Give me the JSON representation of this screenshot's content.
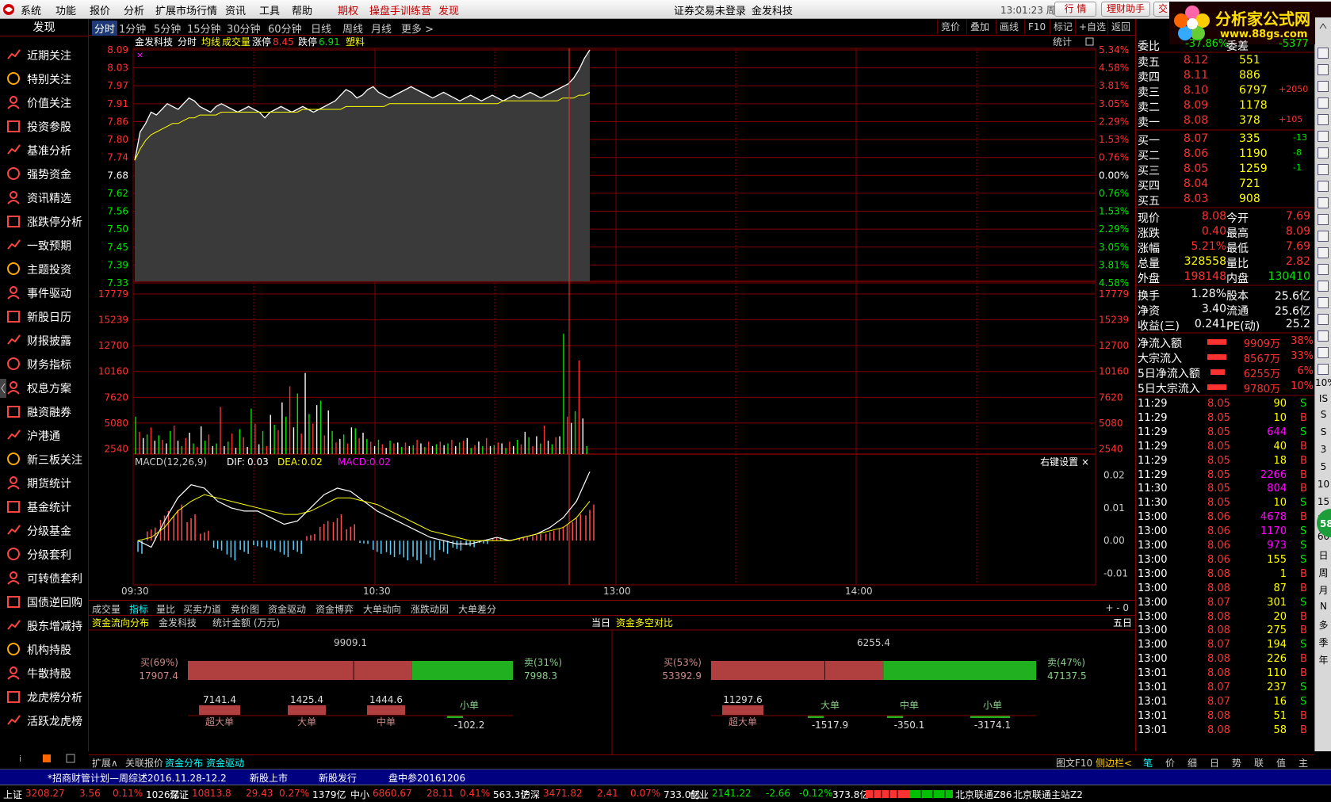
{
  "menu": [
    "系统",
    "功能",
    "报价",
    "分析",
    "扩展市场行情",
    "资讯",
    "工具",
    "帮助"
  ],
  "menu_red": [
    "期权",
    "操盘手训练营",
    "发现"
  ],
  "status_center": "证券交易未登录",
  "stock_name": "金发科技",
  "clock": "13:01:23 周二",
  "top_buttons": [
    "行 情",
    "理财助手",
    "交 易"
  ],
  "logo": {
    "title": "分析家公式网",
    "url": "www.88gs.com"
  },
  "sidebar": {
    "header": "发现",
    "items": [
      "近期关注",
      "特别关注",
      "价值关注",
      "投资参股",
      "基准分析",
      "强势资金",
      "资讯精选",
      "涨跌停分析",
      "一致预期",
      "主题投资",
      "事件驱动",
      "新股日历",
      "财报披露",
      "财务指标",
      "权息方案",
      "融资融券",
      "沪港通",
      "新三板关注",
      "期货统计",
      "基金统计",
      "分级基金",
      "分级套利",
      "可转债套利",
      "国债逆回购",
      "股东增减持",
      "机构持股",
      "牛散持股",
      "龙虎榜分析",
      "活跃龙虎榜"
    ]
  },
  "periods": [
    "分时",
    "1分钟",
    "5分钟",
    "15分钟",
    "30分钟",
    "60分钟",
    "日线",
    "周线",
    "月线",
    "更多 >"
  ],
  "right_buttons": [
    "竞价",
    "叠加",
    "画线",
    "F10",
    "标记",
    "+自选",
    "返回"
  ],
  "chart_header": {
    "name": "金发科技",
    "mode": "分时",
    "avg": "均线",
    "vol": "成交量",
    "limit_up_label": "涨停",
    "limit_up": "8.45",
    "limit_dn_label": "跌停",
    "limit_dn": "6.91",
    "sector": "塑料",
    "stat": "统计"
  },
  "chart_data": {
    "type": "line",
    "price_axis": [
      "8.09",
      "8.03",
      "7.97",
      "7.91",
      "7.86",
      "7.80",
      "7.74",
      "7.68",
      "7.62",
      "7.56",
      "7.50",
      "7.45",
      "7.39",
      "7.33"
    ],
    "pct_axis": [
      "5.34%",
      "4.58%",
      "3.81%",
      "3.05%",
      "2.29%",
      "1.53%",
      "0.76%",
      "0.00%",
      "0.76%",
      "1.53%",
      "2.29%",
      "3.05%",
      "3.81%",
      "4.58%"
    ],
    "base_price": 7.68,
    "ylim": [
      7.3,
      8.09
    ],
    "price": [
      7.7,
      7.8,
      7.83,
      7.87,
      7.86,
      7.88,
      7.9,
      7.89,
      7.88,
      7.9,
      7.92,
      7.91,
      7.89,
      7.88,
      7.87,
      7.89,
      7.9,
      7.89,
      7.88,
      7.87,
      7.88,
      7.89,
      7.88,
      7.87,
      7.85,
      7.87,
      7.88,
      7.89,
      7.88,
      7.87,
      7.88,
      7.89,
      7.88,
      7.87,
      7.88,
      7.89,
      7.9,
      7.91,
      7.93,
      7.95,
      7.94,
      7.92,
      7.93,
      7.95,
      7.96,
      7.94,
      7.93,
      7.92,
      7.93,
      7.94,
      7.95,
      7.96,
      7.95,
      7.94,
      7.93,
      7.92,
      7.93,
      7.94,
      7.93,
      7.92,
      7.91,
      7.92,
      7.93,
      7.92,
      7.91,
      7.92,
      7.93,
      7.92,
      7.91,
      7.92,
      7.93,
      7.92,
      7.93,
      7.94,
      7.93,
      7.92,
      7.93,
      7.94,
      7.95,
      7.96,
      7.97,
      7.99,
      8.02,
      8.06,
      8.09
    ],
    "avg": [
      7.7,
      7.74,
      7.77,
      7.79,
      7.8,
      7.81,
      7.82,
      7.83,
      7.83,
      7.84,
      7.85,
      7.85,
      7.86,
      7.86,
      7.86,
      7.86,
      7.87,
      7.87,
      7.87,
      7.87,
      7.87,
      7.87,
      7.87,
      7.87,
      7.87,
      7.87,
      7.87,
      7.87,
      7.87,
      7.87,
      7.87,
      7.88,
      7.88,
      7.88,
      7.88,
      7.88,
      7.88,
      7.88,
      7.88,
      7.89,
      7.89,
      7.89,
      7.89,
      7.89,
      7.89,
      7.89,
      7.89,
      7.9,
      7.9,
      7.9,
      7.9,
      7.9,
      7.9,
      7.9,
      7.9,
      7.9,
      7.9,
      7.9,
      7.9,
      7.9,
      7.9,
      7.9,
      7.9,
      7.9,
      7.9,
      7.9,
      7.9,
      7.9,
      7.91,
      7.91,
      7.91,
      7.91,
      7.91,
      7.91,
      7.91,
      7.91,
      7.91,
      7.91,
      7.91,
      7.92,
      7.92,
      7.92,
      7.93,
      7.93,
      7.94
    ],
    "vol_axis": [
      "17779",
      "15239",
      "12700",
      "10160",
      "7620",
      "5080",
      "2540"
    ],
    "vol_max": 17779,
    "volume": [
      4200,
      2500,
      1800,
      2200,
      3000,
      1500,
      2100,
      1600,
      1200,
      2600,
      3200,
      1500,
      900,
      1800,
      2400,
      1200,
      800,
      3100,
      1500,
      2200,
      900,
      1200,
      5300,
      900,
      1400,
      2300,
      700,
      2800,
      1900,
      800,
      5100,
      3400,
      1100,
      2600,
      900,
      4400,
      3300,
      2700,
      5800,
      4200,
      7600,
      3000,
      6800,
      2300,
      9100,
      4500,
      3400,
      5500,
      6000,
      2100,
      4900,
      2600,
      1300,
      1700,
      2200,
      1200,
      3000,
      2900,
      1800,
      2400,
      1700,
      1400,
      900,
      1600,
      1100,
      700,
      1500,
      1200,
      1300,
      800,
      1300,
      900,
      1000,
      1600,
      1200,
      800,
      1400,
      900,
      1100,
      1400,
      1000,
      1200,
      1600,
      900,
      1300,
      1500,
      1800,
      700,
      1000,
      1400,
      900,
      1800,
      900,
      1000,
      1300,
      1200,
      700,
      1400,
      900,
      1600,
      1100,
      2500,
      1900,
      900,
      2000,
      1200,
      3200,
      1500,
      1100,
      1900,
      2000,
      13500,
      4200,
      3500,
      4800,
      10500,
      4000,
      900
    ],
    "macd": {
      "label": "MACD(12,26,9)",
      "dif_label": "DIF:",
      "dif": "0.03",
      "dea_label": "DEA:",
      "dea": "0.02",
      "macd_label": "MACD:",
      "macd": "0.02",
      "axis": [
        "0.02",
        "0.01",
        "0.00",
        "-0.01"
      ],
      "ylim": [
        -0.012,
        0.022
      ],
      "dif_line": [
        0.0,
        -0.002,
        0.006,
        0.013,
        0.017,
        0.016,
        0.012,
        0.01,
        0.009,
        0.009,
        0.007,
        0.005,
        0.006,
        0.01,
        0.014,
        0.016,
        0.015,
        0.012,
        0.009,
        0.007,
        0.005,
        0.003,
        0.001,
        0.0,
        -0.001,
        -0.001,
        0.0,
        0.001,
        0.0,
        0.001,
        0.002,
        0.004,
        0.007,
        0.012,
        0.021
      ],
      "dea_line": [
        0.0,
        0.001,
        0.004,
        0.009,
        0.012,
        0.014,
        0.013,
        0.012,
        0.011,
        0.01,
        0.009,
        0.008,
        0.008,
        0.009,
        0.011,
        0.013,
        0.013,
        0.012,
        0.011,
        0.009,
        0.007,
        0.005,
        0.003,
        0.002,
        0.001,
        0.0,
        0.0,
        0.0,
        0.0,
        0.001,
        0.002,
        0.003,
        0.004,
        0.007,
        0.012
      ],
      "bars": [
        -0.004,
        0.004,
        0.009,
        0.011,
        0.008,
        0.003,
        -0.003,
        -0.006,
        -0.004,
        -0.002,
        -0.003,
        -0.005,
        -0.004,
        0.002,
        0.006,
        0.008,
        0.005,
        -0.001,
        -0.004,
        -0.005,
        -0.006,
        -0.007,
        -0.006,
        -0.004,
        -0.003,
        -0.002,
        -0.001,
        0.001,
        0.0,
        0.001,
        0.002,
        0.003,
        0.005,
        0.008,
        0.011
      ]
    },
    "time_axis": [
      "09:30",
      "10:30",
      "13:00",
      "14:00"
    ],
    "right_setting": "右键设置 ×"
  },
  "subtabs": [
    "成交量",
    "指标",
    "量比",
    "买卖力道",
    "竞价图",
    "资金驱动",
    "资金博弈",
    "大单动向",
    "涨跌动因",
    "大单差分"
  ],
  "subtab_ctrl": "+ - 0",
  "fund_panel": {
    "tab1": "资金流向分布",
    "stock": "金发科技",
    "unit": "统计金额 (万元)",
    "period1": "当日",
    "tab2": "资金多空对比",
    "period2": "五日 ▼",
    "left": {
      "net": "9909.1",
      "buy_label": "买(69%)",
      "buy": "17907.4",
      "sell_label": "卖(31%)",
      "sell": "7998.3",
      "buy_ratio": 0.69,
      "cats": [
        {
          "name": "超大单",
          "value": "7141.4"
        },
        {
          "name": "大单",
          "value": "1425.4"
        },
        {
          "name": "中单",
          "value": "1444.6"
        },
        {
          "name": "小单",
          "value": "-102.2"
        }
      ]
    },
    "right": {
      "net": "6255.4",
      "buy_label": "买(53%)",
      "buy": "53392.9",
      "sell_label": "卖(47%)",
      "sell": "47137.5",
      "buy_ratio": 0.53,
      "cats": [
        {
          "name": "超大单",
          "value": "11297.6"
        },
        {
          "name": "大单",
          "value": "-1517.9"
        },
        {
          "name": "中单",
          "value": "-350.1"
        },
        {
          "name": "小单",
          "value": "-3174.1"
        }
      ]
    }
  },
  "quote": {
    "weibi_label": "委比",
    "weibi": "-37.86%",
    "weicha_label": "委差",
    "weicha": "-5377",
    "asks": [
      {
        "label": "卖五",
        "price": "8.12",
        "vol": "551",
        "chg": ""
      },
      {
        "label": "卖四",
        "price": "8.11",
        "vol": "886",
        "chg": ""
      },
      {
        "label": "卖三",
        "price": "8.10",
        "vol": "6797",
        "chg": "+2050"
      },
      {
        "label": "卖二",
        "price": "8.09",
        "vol": "1178",
        "chg": ""
      },
      {
        "label": "卖一",
        "price": "8.08",
        "vol": "378",
        "chg": "+105"
      }
    ],
    "bids": [
      {
        "label": "买一",
        "price": "8.07",
        "vol": "335",
        "chg": "-13"
      },
      {
        "label": "买二",
        "price": "8.06",
        "vol": "1190",
        "chg": "-8"
      },
      {
        "label": "买三",
        "price": "8.05",
        "vol": "1259",
        "chg": "-1"
      },
      {
        "label": "买四",
        "price": "8.04",
        "vol": "721",
        "chg": ""
      },
      {
        "label": "买五",
        "price": "8.03",
        "vol": "908",
        "chg": ""
      }
    ],
    "stats": [
      [
        "现价",
        "8.08",
        "今开",
        "7.69"
      ],
      [
        "涨跌",
        "0.40",
        "最高",
        "8.09"
      ],
      [
        "涨幅",
        "5.21%",
        "最低",
        "7.69"
      ],
      [
        "总量",
        "328558",
        "量比",
        "2.82"
      ],
      [
        "外盘",
        "198148",
        "内盘",
        "130410"
      ]
    ],
    "stats2": [
      [
        "换手",
        "1.28%",
        "股本",
        "25.6亿"
      ],
      [
        "净资",
        "3.40",
        "流通",
        "25.6亿"
      ],
      [
        "收益(三)",
        "0.241",
        "PE(动)",
        "25.2"
      ]
    ],
    "flows": [
      {
        "label": "净流入额",
        "value": "9909万",
        "pct": "38%"
      },
      {
        "label": "大宗流入",
        "value": "8567万",
        "pct": "33%"
      },
      {
        "label": "5日净流入额",
        "value": "6255万",
        "pct": "6%"
      },
      {
        "label": "5日大宗流入",
        "value": "9780万",
        "pct": "10%"
      }
    ],
    "ticks": [
      [
        "11:29",
        "8.05",
        "90",
        "S"
      ],
      [
        "11:29",
        "8.05",
        "10",
        "B"
      ],
      [
        "11:29",
        "8.05",
        "644",
        "S"
      ],
      [
        "11:29",
        "8.05",
        "40",
        "B"
      ],
      [
        "11:29",
        "8.05",
        "18",
        "B"
      ],
      [
        "11:29",
        "8.05",
        "2266",
        "B"
      ],
      [
        "11:30",
        "8.05",
        "804",
        "B"
      ],
      [
        "11:30",
        "8.05",
        "10",
        "S"
      ],
      [
        "13:00",
        "8.06",
        "4678",
        "B"
      ],
      [
        "13:00",
        "8.06",
        "1170",
        "S"
      ],
      [
        "13:00",
        "8.06",
        "973",
        "S"
      ],
      [
        "13:00",
        "8.06",
        "155",
        "S"
      ],
      [
        "13:00",
        "8.08",
        "1",
        "B"
      ],
      [
        "13:00",
        "8.08",
        "87",
        "B"
      ],
      [
        "13:00",
        "8.07",
        "301",
        "S"
      ],
      [
        "13:00",
        "8.08",
        "20",
        "B"
      ],
      [
        "13:00",
        "8.08",
        "275",
        "B"
      ],
      [
        "13:00",
        "8.07",
        "194",
        "S"
      ],
      [
        "13:00",
        "8.08",
        "226",
        "B"
      ],
      [
        "13:01",
        "8.08",
        "110",
        "B"
      ],
      [
        "13:01",
        "8.07",
        "237",
        "S"
      ],
      [
        "13:01",
        "8.07",
        "16",
        "S"
      ],
      [
        "13:01",
        "8.08",
        "51",
        "B"
      ],
      [
        "13:01",
        "8.08",
        "58",
        "B"
      ]
    ]
  },
  "right_tools": [
    "10%",
    "IS",
    "S",
    "S",
    "3",
    "5",
    "10",
    "15",
    "30",
    "60",
    "日",
    "周",
    "月",
    "N",
    "多",
    "季",
    "年"
  ],
  "bottom_tabs": [
    "扩展∧",
    "关联报价",
    "资金分布",
    "资金驱动"
  ],
  "bottom_right": [
    "图文F10",
    "侧边栏<"
  ],
  "rtabs": [
    "笔",
    "价",
    "细",
    "日",
    "势",
    "联",
    "值",
    "主"
  ],
  "news": [
    "*招商财管计划—周综述2016.11.28-12.2",
    "新股上市",
    "新股发行",
    "盘中参20161206"
  ],
  "status": [
    {
      "name": "上证",
      "price": "3208.27",
      "chg": "3.56",
      "pct": "0.11%",
      "amt": "1026亿"
    },
    {
      "name": "深证",
      "price": "10813.8",
      "chg": "29.43",
      "pct": "0.27%",
      "amt": "1379亿"
    },
    {
      "name": "中小",
      "price": "6860.67",
      "chg": "28.11",
      "pct": "0.41%",
      "amt": "563.3亿"
    },
    {
      "name": "沪深",
      "price": "3471.82",
      "chg": "2.41",
      "pct": "0.07%",
      "amt": "733.0亿"
    },
    {
      "name": "创业",
      "price": "2141.22",
      "chg": "-2.66",
      "pct": "-0.12%",
      "amt": "373.8亿"
    }
  ],
  "conn": [
    "北京联通Z86",
    "北京联通主站Z2"
  ],
  "colors": {
    "up": "#ff3232",
    "down": "#00e600",
    "grid": "#800000",
    "price": "#ffffff",
    "avg": "#ffff00"
  }
}
